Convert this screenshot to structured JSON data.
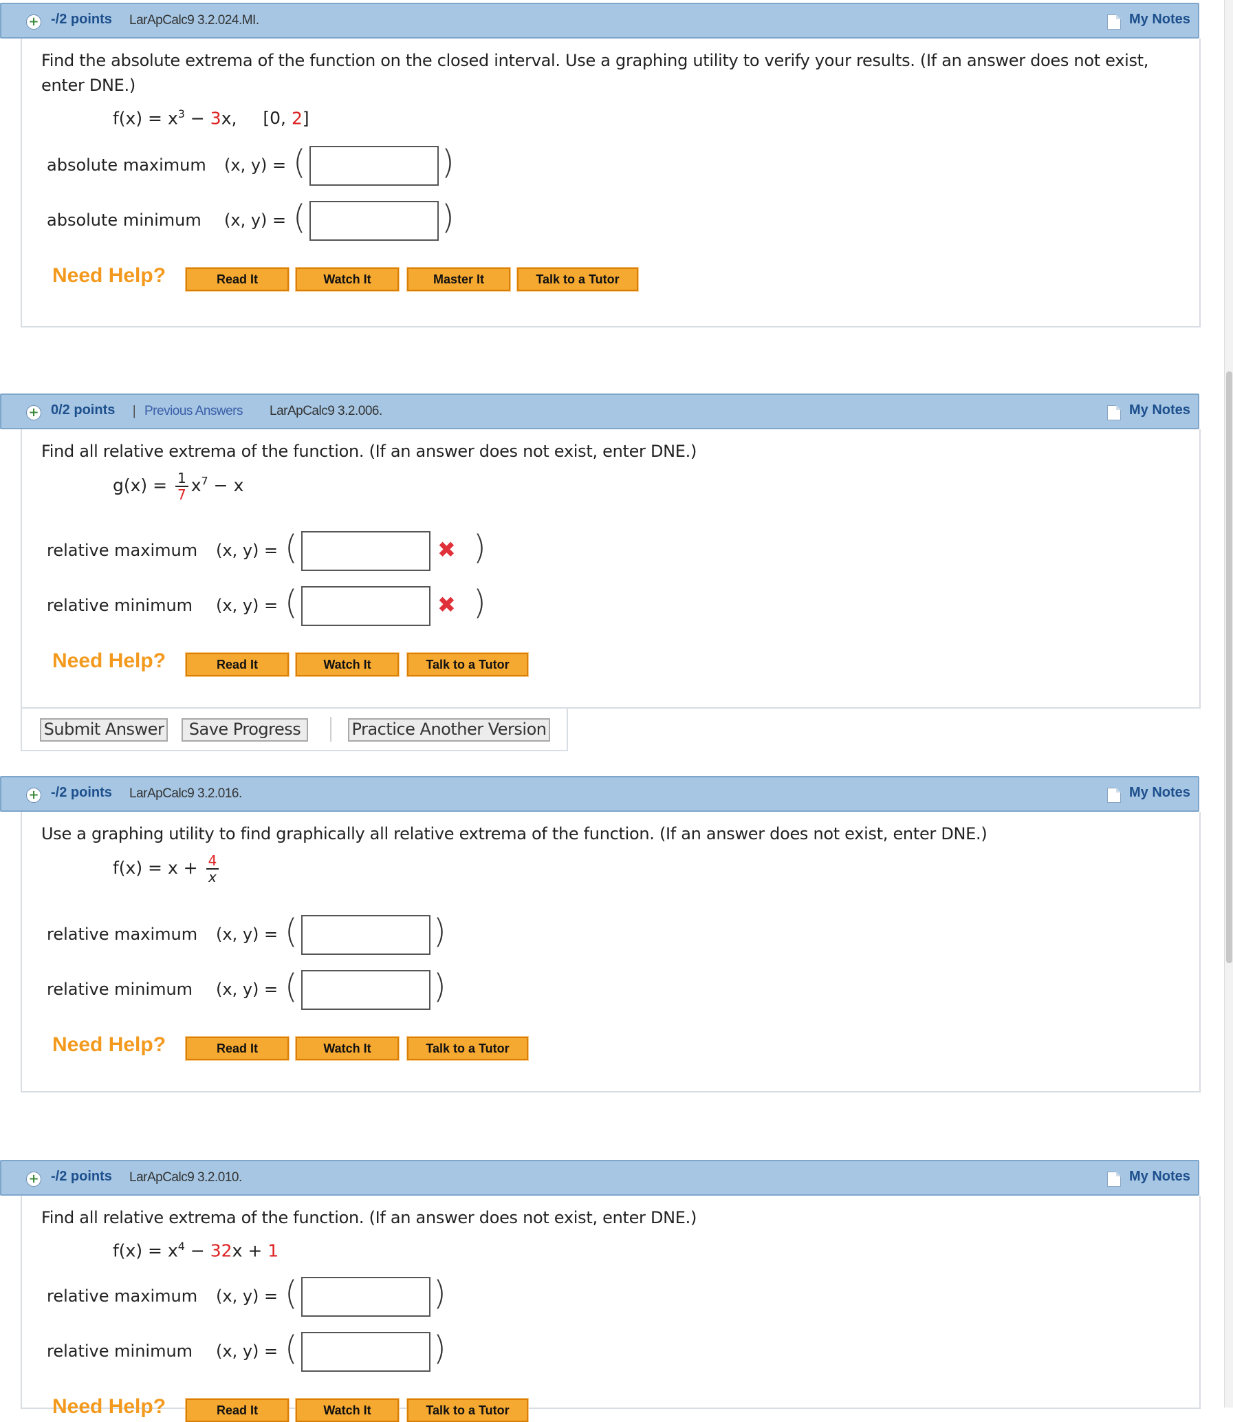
{
  "questions": [
    {
      "points": "-/2 points",
      "id": "LarApCalc9 3.2.024.MI.",
      "notes": "My Notes",
      "prompt": "Find the absolute extrema of the function on the closed interval. Use a graphing utility to verify your results. (If an answer does not exist, enter DNE.)",
      "rows": [
        {
          "label": "absolute maximum",
          "xy": "(x, y) ="
        },
        {
          "label": "absolute minimum",
          "xy": "(x, y) ="
        }
      ],
      "help_label": "Need Help?",
      "help_buttons": [
        "Read It",
        "Watch It",
        "Master It",
        "Talk to a Tutor"
      ]
    },
    {
      "points": "0/2 points",
      "separator": "|",
      "previous_answers": "Previous Answers",
      "id": "LarApCalc9 3.2.006.",
      "notes": "My Notes",
      "prompt": "Find all relative extrema of the function. (If an answer does not exist, enter DNE.)",
      "rows": [
        {
          "label": "relative maximum",
          "xy": "(x, y) ="
        },
        {
          "label": "relative minimum",
          "xy": "(x, y) ="
        }
      ],
      "help_label": "Need Help?",
      "help_buttons": [
        "Read It",
        "Watch It",
        "Talk to a Tutor"
      ]
    },
    {
      "points": "-/2 points",
      "id": "LarApCalc9 3.2.016.",
      "notes": "My Notes",
      "prompt": "Use a graphing utility to find graphically all relative extrema of the function. (If an answer does not exist, enter DNE.)",
      "rows": [
        {
          "label": "relative maximum",
          "xy": "(x, y) ="
        },
        {
          "label": "relative minimum",
          "xy": "(x, y) ="
        }
      ],
      "help_label": "Need Help?",
      "help_buttons": [
        "Read It",
        "Watch It",
        "Talk to a Tutor"
      ]
    },
    {
      "points": "-/2 points",
      "id": "LarApCalc9 3.2.010.",
      "notes": "My Notes",
      "prompt": "Find all relative extrema of the function. (If an answer does not exist, enter DNE.)",
      "rows": [
        {
          "label": "relative maximum",
          "xy": "(x, y) ="
        },
        {
          "label": "relative minimum",
          "xy": "(x, y) ="
        }
      ],
      "help_label": "Need Help?",
      "help_buttons": [
        "Read It",
        "Watch It",
        "Talk to a Tutor"
      ]
    }
  ],
  "formulas": {
    "q1": {
      "lhs": "f(x) = x",
      "exp": "3",
      "minus": " − ",
      "coef": "3",
      "var": "x,",
      "interval_open": "[0, ",
      "interval_end": "2",
      "interval_close": "]"
    },
    "q2": {
      "lhs": "g(x) = ",
      "num": "1",
      "den": "7",
      "xpow": "x",
      "exp": "7",
      "rest": " − x"
    },
    "q3": {
      "lhs": "f(x) = x + ",
      "num": "4",
      "den": "x"
    },
    "q4": {
      "lhs": "f(x) = x",
      "exp": "4",
      "minus": " − ",
      "coef": "32",
      "var": "x + ",
      "const": "1"
    }
  },
  "footer": {
    "submit": "Submit Answer",
    "save": "Save Progress",
    "practice": "Practice Another Version"
  },
  "status": {
    "incorrect_mark": "✖"
  },
  "colors": {
    "header_bg": "#a6c6e3",
    "help_orange": "#f39a1e",
    "button_orange": "#f6a931",
    "incorrect_red": "#e0313a",
    "number_red": "#d22"
  }
}
